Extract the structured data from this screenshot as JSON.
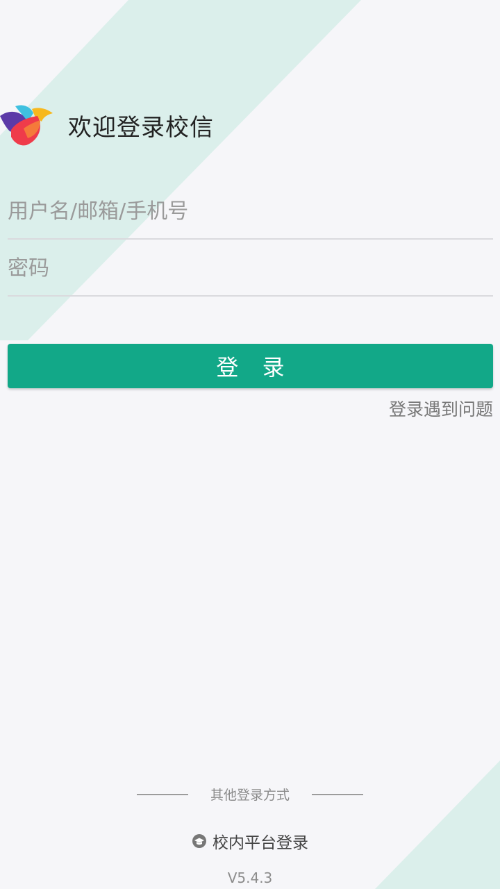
{
  "header": {
    "logo_icon": "colorful-bird-logo",
    "welcome_text": "欢迎登录校信"
  },
  "form": {
    "username_placeholder": "用户名/邮箱/手机号",
    "password_placeholder": "密码",
    "login_label": "登 录",
    "problem_link": "登录遇到问题"
  },
  "footer": {
    "other_methods_label": "其他登录方式",
    "campus_login_icon": "school-cap-icon",
    "campus_login_label": "校内平台登录",
    "version": "V5.4.3"
  },
  "colors": {
    "background": "#f6f6f9",
    "accent": "#12a888",
    "decor_band": "#dbefeb"
  }
}
